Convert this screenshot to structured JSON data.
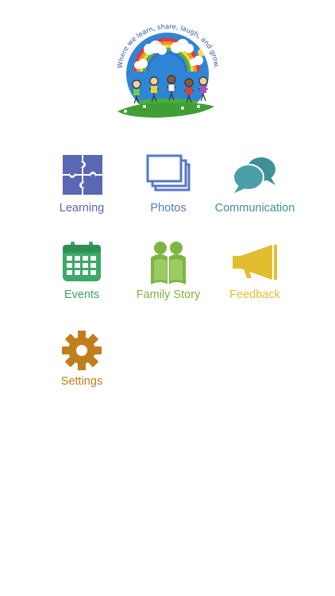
{
  "logo": {
    "motto": "Where we learn, share, laugh, and grow."
  },
  "menu": {
    "items": [
      {
        "label": "Learning",
        "icon": "puzzle-icon",
        "color": "#5a67b3"
      },
      {
        "label": "Photos",
        "icon": "photos-icon",
        "color": "#5578c4"
      },
      {
        "label": "Communication",
        "icon": "chat-icon",
        "color": "#3f8f95"
      },
      {
        "label": "Events",
        "icon": "calendar-icon",
        "color": "#3da867"
      },
      {
        "label": "Family Story",
        "icon": "family-book-icon",
        "color": "#7cb542"
      },
      {
        "label": "Feedback",
        "icon": "megaphone-icon",
        "color": "#e2bd2f"
      },
      {
        "label": "Settings",
        "icon": "gear-icon",
        "color": "#c17e1d"
      }
    ]
  }
}
